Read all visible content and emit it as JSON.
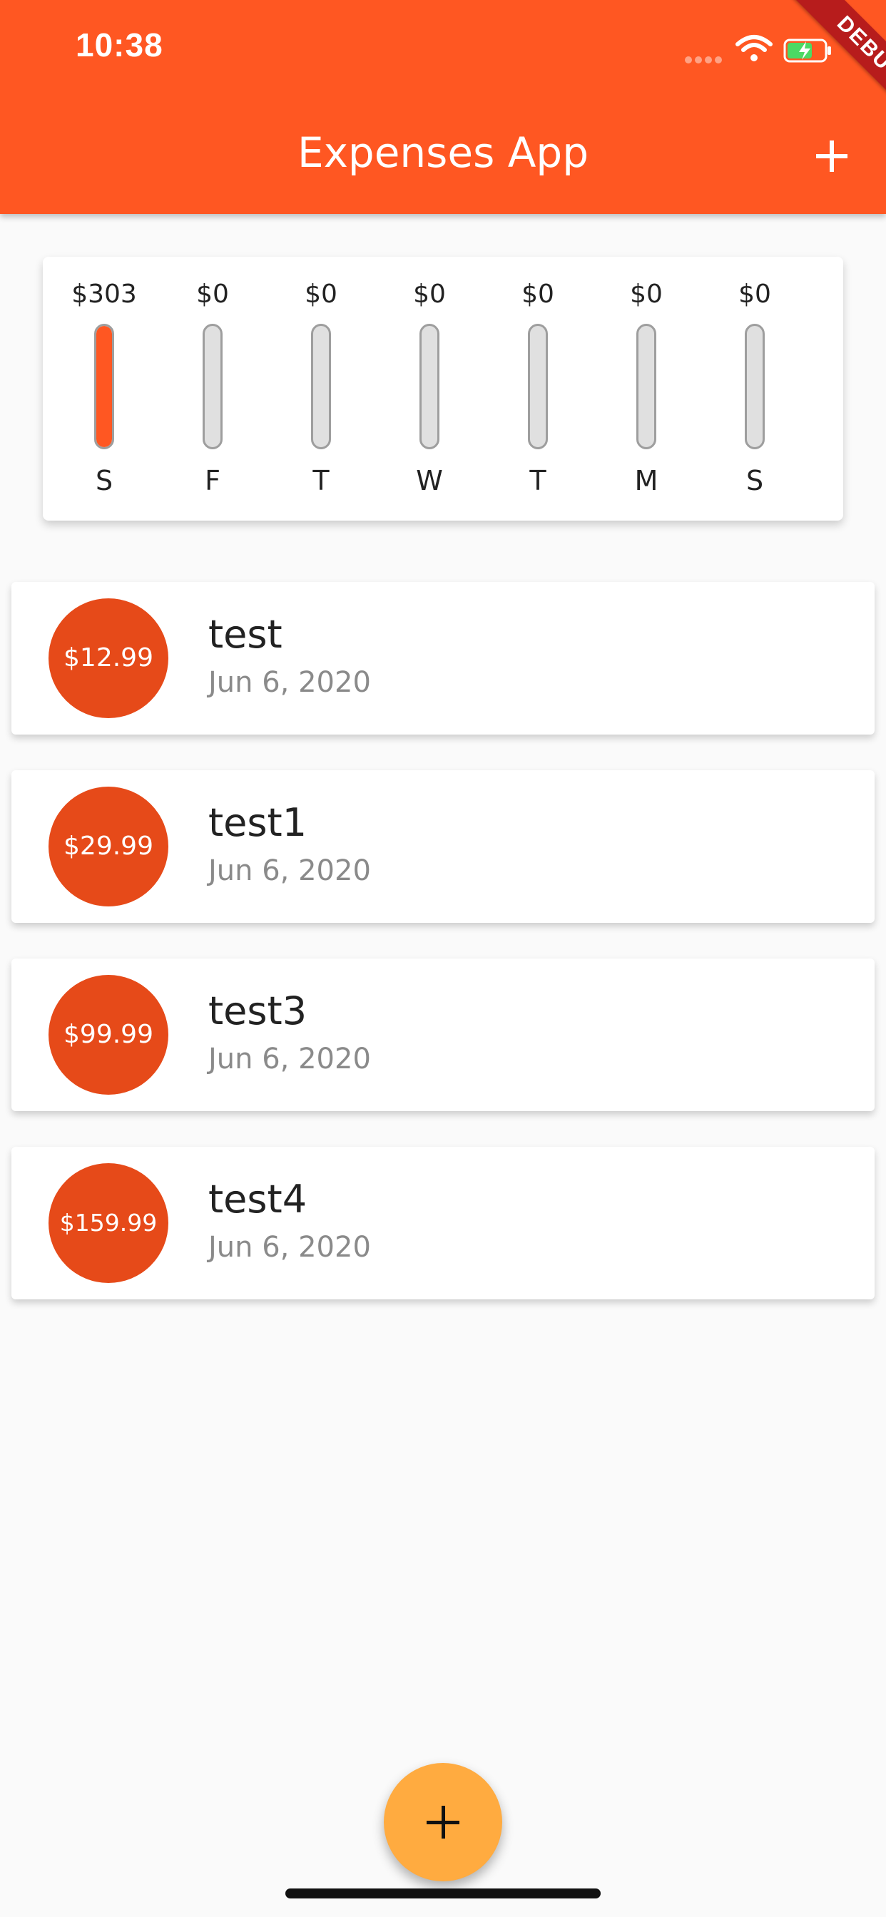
{
  "status_bar": {
    "time": "10:38",
    "icons": [
      "signal-icon",
      "wifi-icon",
      "battery-charging-icon"
    ]
  },
  "debug_banner": "DEBUG",
  "app_bar": {
    "title": "Expenses App",
    "action_icon": "plus-icon"
  },
  "chart": {
    "days": [
      {
        "day": "S",
        "amount": "$303",
        "fraction": 1.0
      },
      {
        "day": "F",
        "amount": "$0",
        "fraction": 0
      },
      {
        "day": "T",
        "amount": "$0",
        "fraction": 0
      },
      {
        "day": "W",
        "amount": "$0",
        "fraction": 0
      },
      {
        "day": "T",
        "amount": "$0",
        "fraction": 0
      },
      {
        "day": "M",
        "amount": "$0",
        "fraction": 0
      },
      {
        "day": "S",
        "amount": "$0",
        "fraction": 0
      }
    ]
  },
  "transactions": [
    {
      "amount": "$12.99",
      "title": "test",
      "date": "Jun 6, 2020"
    },
    {
      "amount": "$29.99",
      "title": "test1",
      "date": "Jun 6, 2020"
    },
    {
      "amount": "$99.99",
      "title": "test3",
      "date": "Jun 6, 2020"
    },
    {
      "amount": "$159.99",
      "title": "test4",
      "date": "Jun 6, 2020"
    }
  ],
  "fab_icon": "plus-icon",
  "colors": {
    "primary": "#ff5722",
    "avatar": "#e64a19",
    "accent": "#ffab40",
    "background": "#fafafa"
  }
}
